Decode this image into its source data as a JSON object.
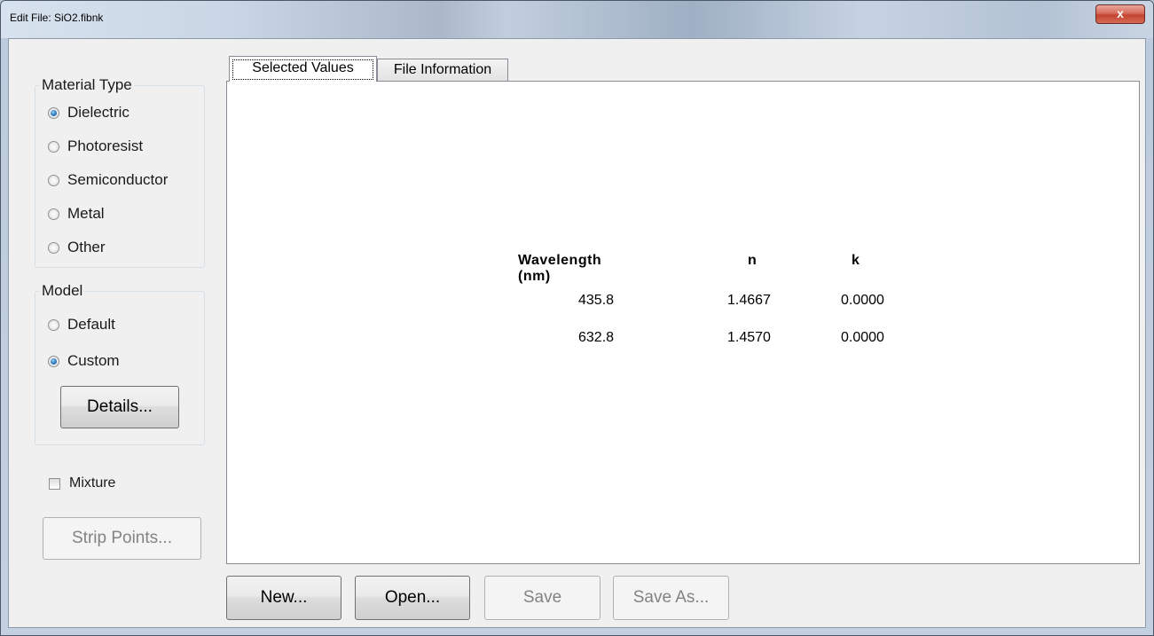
{
  "window": {
    "title": "Edit File: SiO2.fibnk",
    "close_glyph": "x"
  },
  "material_type": {
    "label": "Material Type",
    "options": [
      "Dielectric",
      "Photoresist",
      "Semiconductor",
      "Metal",
      "Other"
    ],
    "selected": "Dielectric"
  },
  "model": {
    "label": "Model",
    "options": [
      "Default",
      "Custom"
    ],
    "selected": "Custom",
    "details_label": "Details..."
  },
  "mixture": {
    "label": "Mixture",
    "checked": false
  },
  "strip_points_label": "Strip Points...",
  "tabs": [
    {
      "label": "Selected Values",
      "active": true
    },
    {
      "label": "File Information",
      "active": false
    }
  ],
  "table": {
    "headers": [
      "Wavelength (nm)",
      "n",
      "k"
    ],
    "rows": [
      [
        "435.8",
        "1.4667",
        "0.0000"
      ],
      [
        "632.8",
        "1.4570",
        "0.0000"
      ]
    ]
  },
  "buttons": {
    "new": "New...",
    "open": "Open...",
    "save": "Save",
    "save_as": "Save As..."
  }
}
